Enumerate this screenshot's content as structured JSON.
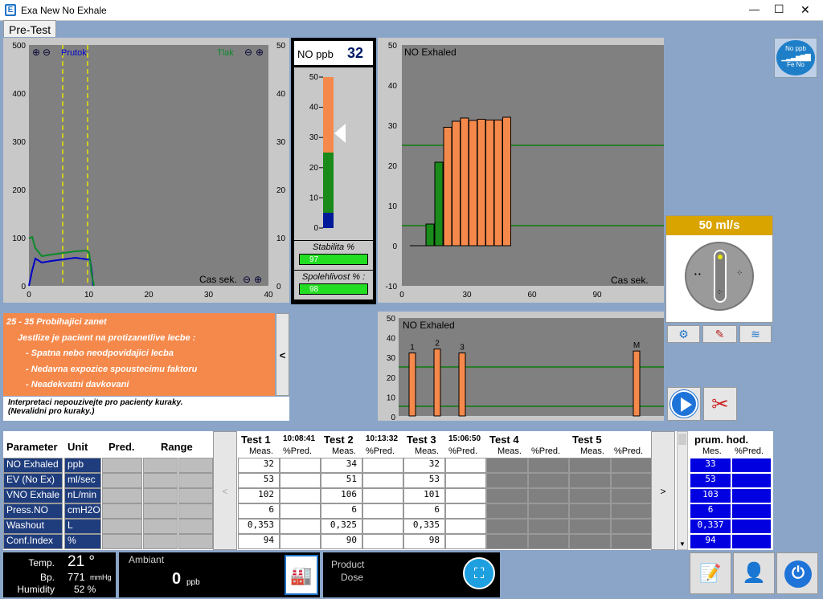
{
  "window": {
    "title": "Exa New No Exhale",
    "minimize": "—",
    "maximize": "☐",
    "close": "✕"
  },
  "tab": {
    "label": "Pre-Test"
  },
  "flow_chart": {
    "left_ticks": [
      "500",
      "400",
      "300",
      "200",
      "100",
      "0"
    ],
    "right_ticks": [
      "50",
      "40",
      "30",
      "20",
      "10",
      "0"
    ],
    "x_ticks": [
      "0",
      "10",
      "20",
      "30",
      "40"
    ],
    "label_flow": "Prutok",
    "label_pressure": "Tlak",
    "xlabel": "Cas sek."
  },
  "gauge": {
    "title": "NO ppb",
    "value": "32",
    "ticks": [
      "50",
      "40",
      "30",
      "20",
      "10",
      "0"
    ],
    "stability_label": "Stabilita %",
    "stability_value": "97",
    "reliability_label": "Spolehlivost % :",
    "reliability_value": "98"
  },
  "main_chart": {
    "title": "NO Exhaled",
    "y_ticks": [
      "50",
      "40",
      "30",
      "20",
      "10",
      "0",
      "-10"
    ],
    "x_ticks": [
      "0",
      "30",
      "60",
      "90"
    ],
    "xlabel": "Cas sek."
  },
  "flow_rate": {
    "value": "50 ml/s"
  },
  "fe_no_badge": {
    "line1": "No ppb",
    "line2": "Fe No"
  },
  "interpretation": {
    "lines": [
      "25 - 35   Probihajici zanet",
      "Jestlize je pacient na protizanetlive lecbe :",
      "- Spatna nebo neodpovidajici lecba",
      "- Nedavna expozice spoustecimu faktoru",
      "- Neadekvatni davkovani"
    ],
    "note": "Interpretaci nepouzivejte pro pacienty kuraky.\n(Nevalidni pro kuraky.)",
    "collapse": "<"
  },
  "summary_chart": {
    "title": "NO Exhaled",
    "y_ticks": [
      "50",
      "40",
      "30",
      "20",
      "10",
      "0"
    ],
    "bar_labels": [
      "1",
      "2",
      "3",
      "M"
    ]
  },
  "table": {
    "headers": {
      "parameter": "Parameter",
      "unit": "Unit",
      "pred": "Pred.",
      "range": "Range"
    },
    "rows": [
      {
        "param": "NO Exhaled",
        "unit": "ppb"
      },
      {
        "param": "EV (No Ex)",
        "unit": "ml/sec"
      },
      {
        "param": "VNO Exhale",
        "unit": "nL/min"
      },
      {
        "param": "Press.NO",
        "unit": "cmH2O"
      },
      {
        "param": "Washout",
        "unit": "L"
      },
      {
        "param": "Conf.Index",
        "unit": "%"
      }
    ],
    "tests": [
      {
        "name": "Test 1",
        "time": "10:08:41",
        "meas": "Meas.",
        "pred": "%Pred.",
        "values": [
          "32",
          "53",
          "102",
          "6",
          "0,353",
          "94"
        ]
      },
      {
        "name": "Test 2",
        "time": "10:13:32",
        "meas": "Meas.",
        "pred": "%Pred.",
        "values": [
          "34",
          "51",
          "106",
          "6",
          "0,325",
          "90"
        ]
      },
      {
        "name": "Test 3",
        "time": "15:06:50",
        "meas": "Meas.",
        "pred": "%Pred.",
        "values": [
          "32",
          "53",
          "101",
          "6",
          "0,335",
          "98"
        ]
      },
      {
        "name": "Test 4",
        "time": "",
        "meas": "Meas.",
        "pred": "%Pred.",
        "values": [
          "",
          "",
          "",
          "",
          "",
          ""
        ]
      },
      {
        "name": "Test 5",
        "time": "",
        "meas": "Meas.",
        "pred": "%Pred.",
        "values": [
          "",
          "",
          "",
          "",
          "",
          ""
        ]
      }
    ],
    "nav_left": "<",
    "nav_right": ">",
    "avg": {
      "title": "prum. hod.",
      "meas": "Mes.",
      "pred": "%Pred.",
      "values": [
        "33",
        "53",
        "103",
        "6",
        "0,337",
        "94"
      ]
    }
  },
  "status": {
    "temp_label": "Temp.",
    "temp_value": "21 °",
    "bp_label": "Bp.",
    "bp_value": "771",
    "bp_unit": "mmHg",
    "humidity_label": "Humidity",
    "humidity_value": "52 %",
    "ambiant_label": "Ambiant",
    "ambiant_value": "0",
    "ambiant_unit": "ppb",
    "product_label": "Product",
    "dose_label": "Dose"
  }
}
